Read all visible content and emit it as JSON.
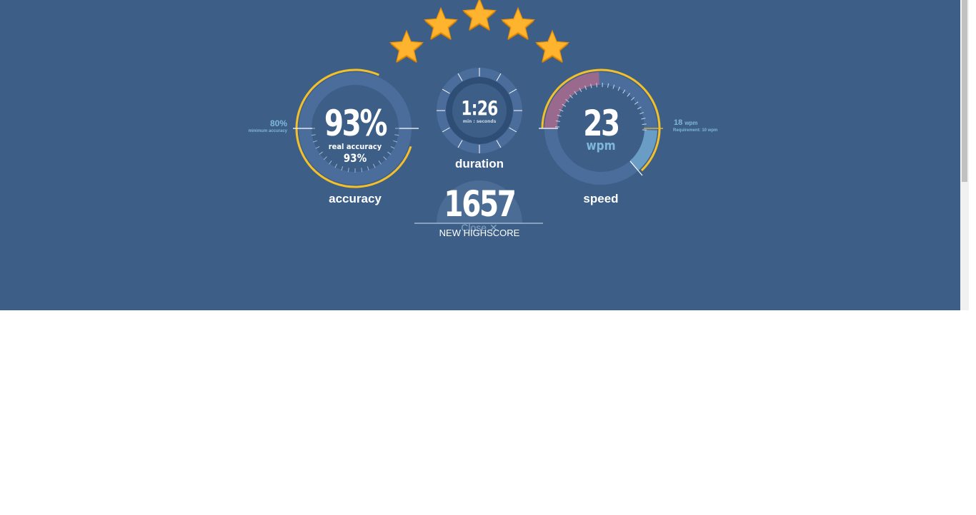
{
  "stars": {
    "count": 5,
    "earned": 5,
    "color": "#ffa51a"
  },
  "accuracy": {
    "value": "93%",
    "real_label": "real accuracy",
    "real_value": "93%",
    "label": "accuracy",
    "minimum_value": "80%",
    "minimum_label": "minimum accuracy",
    "level": 0.93,
    "minimum_level": 0.8
  },
  "duration": {
    "value": "1:26",
    "unit_label": "min : seconds",
    "label": "duration"
  },
  "speed": {
    "value": "23",
    "unit": "wpm",
    "label": "speed",
    "requirement_value": "18",
    "requirement_unit": "wpm",
    "requirement_label": "Requirement: 10 wpm"
  },
  "score": {
    "value": "1657",
    "close_label": "Close",
    "highscore_label": "NEW HIGHSCORE"
  },
  "colors": {
    "background": "#3d5f87",
    "ring": "#4a6d9c",
    "gold": "#f4c02a",
    "pink": "#9a6a8e",
    "light_blue": "#7fb6dc"
  }
}
